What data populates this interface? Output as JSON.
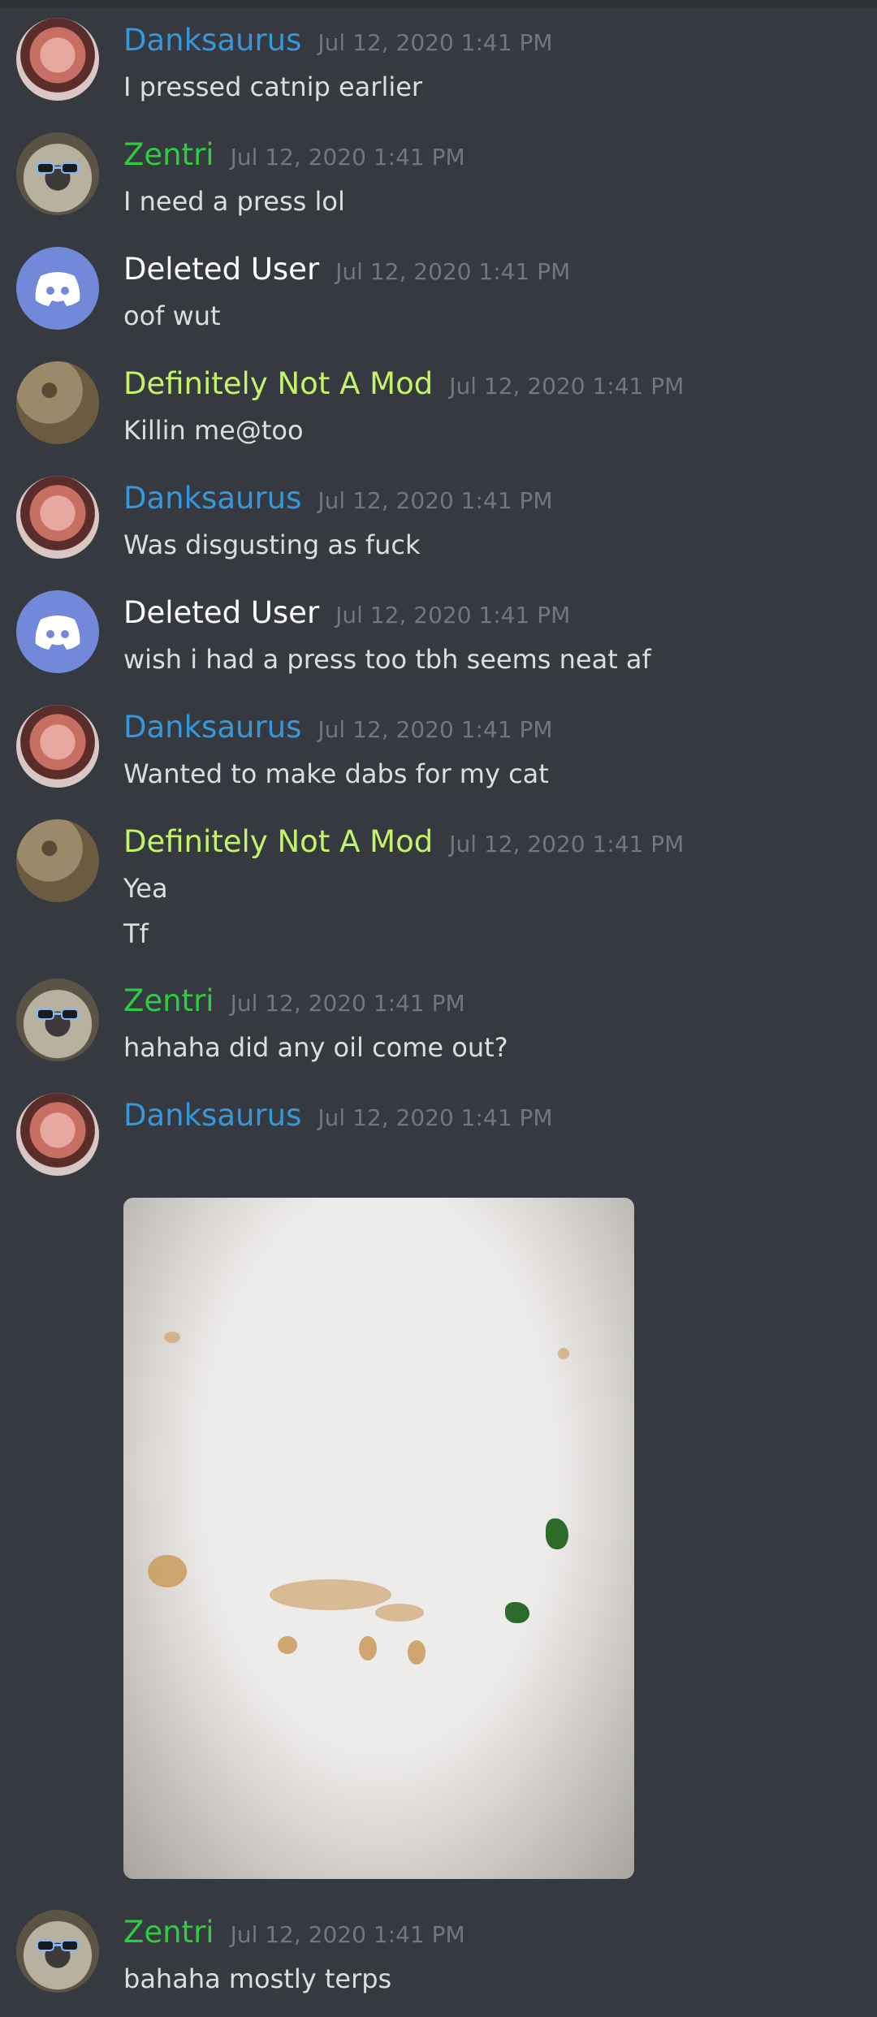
{
  "messages": [
    {
      "author": "Danksaurus",
      "time": "Jul 12, 2020 1:41 PM",
      "lines": [
        "I pressed catnip earlier"
      ]
    },
    {
      "author": "Zentri",
      "time": "Jul 12, 2020 1:41 PM",
      "lines": [
        "I need a press lol"
      ]
    },
    {
      "author": "Deleted User",
      "time": "Jul 12, 2020 1:41 PM",
      "lines": [
        "oof wut"
      ]
    },
    {
      "author": "Definitely Not A Mod",
      "time": "Jul 12, 2020 1:41 PM",
      "lines": [
        "Killin me@too"
      ]
    },
    {
      "author": "Danksaurus",
      "time": "Jul 12, 2020 1:41 PM",
      "lines": [
        "Was disgusting as fuck"
      ]
    },
    {
      "author": "Deleted User",
      "time": "Jul 12, 2020 1:41 PM",
      "lines": [
        "wish i had a press too tbh seems neat af"
      ]
    },
    {
      "author": "Danksaurus",
      "time": "Jul 12, 2020 1:41 PM",
      "lines": [
        "Wanted to make dabs for my cat"
      ]
    },
    {
      "author": "Definitely Not A Mod",
      "time": "Jul 12, 2020 1:41 PM",
      "lines": [
        "Yea",
        "Tf"
      ]
    },
    {
      "author": "Zentri",
      "time": "Jul 12, 2020 1:41 PM",
      "lines": [
        "hahaha did any oil come out?"
      ]
    },
    {
      "author": "Danksaurus",
      "time": "Jul 12, 2020 1:41 PM",
      "lines": []
    },
    {
      "author": "Zentri",
      "time": "Jul 12, 2020 1:41 PM",
      "lines": [
        "bahaha mostly terps"
      ]
    }
  ],
  "colors": {
    "background": "#36393f",
    "Danksaurus": "#3498db",
    "Zentri": "#2ecc40",
    "Deleted User": "#ffffff",
    "Definitely Not A Mod": "#c2f36a",
    "timestamp": "#72767d"
  },
  "icons": {
    "deleted_avatar": "discord-logo-icon"
  }
}
